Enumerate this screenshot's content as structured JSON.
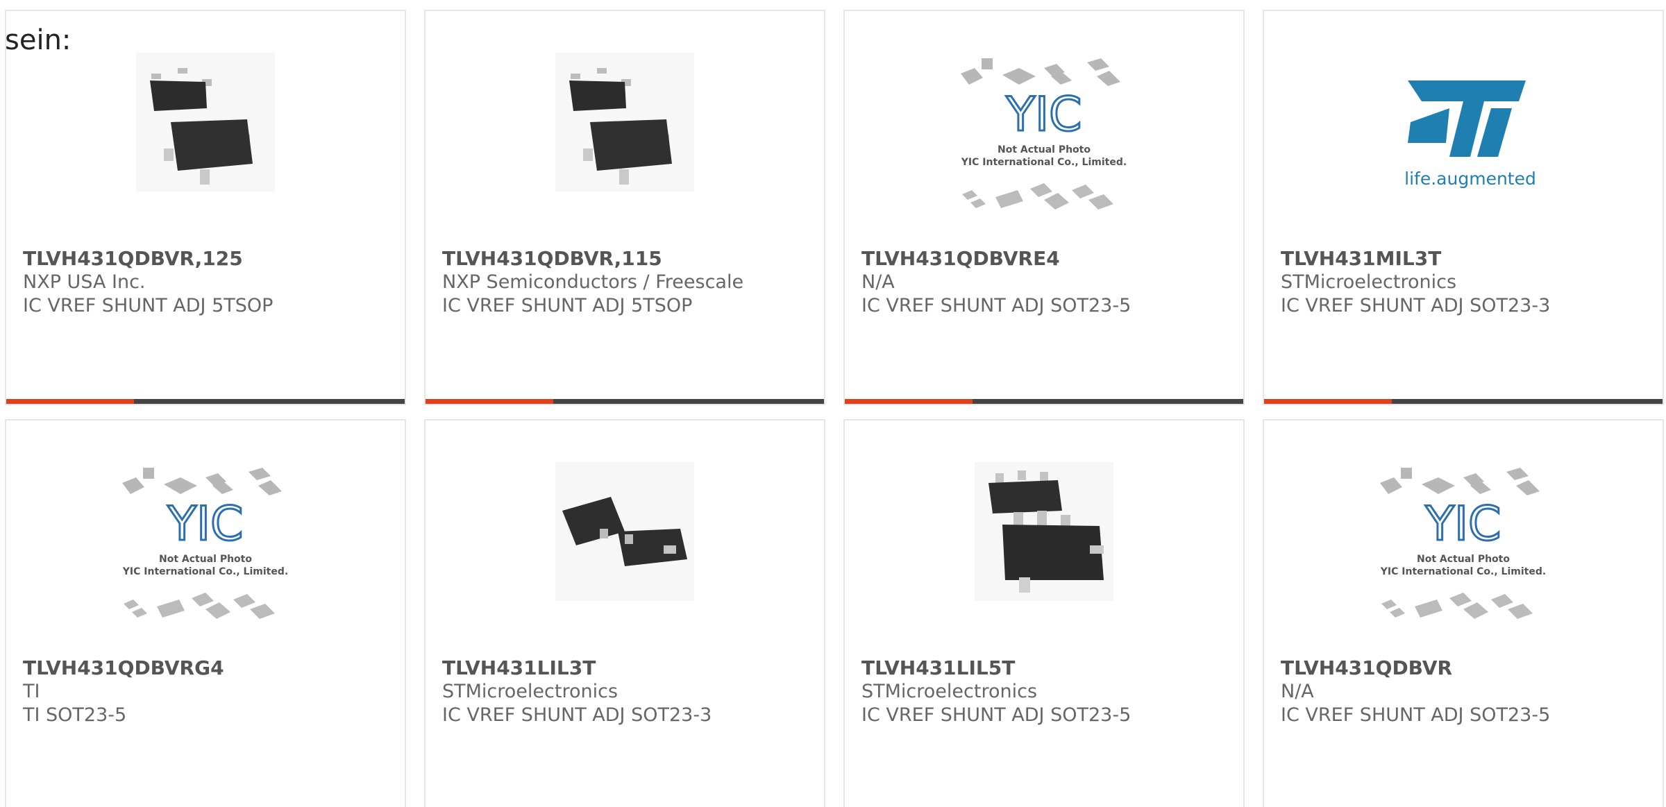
{
  "intro_text": "sein:",
  "colors": {
    "accent": "#e2401c",
    "bar": "#444444",
    "st_logo_blue": "#1e7fb0",
    "yic_blue": "#2b6fb0"
  },
  "products": [
    {
      "part_number": "TLVH431QDBVR,125",
      "manufacturer": "NXP USA Inc.",
      "description": "IC VREF SHUNT ADJ 5TSOP",
      "image": "chip-photo"
    },
    {
      "part_number": "TLVH431QDBVR,115",
      "manufacturer": "NXP Semiconductors / Freescale",
      "description": "IC VREF SHUNT ADJ 5TSOP",
      "image": "chip-photo"
    },
    {
      "part_number": "TLVH431QDBVRE4",
      "manufacturer": "N/A",
      "description": "IC VREF SHUNT ADJ SOT23-5",
      "image": "yic-placeholder"
    },
    {
      "part_number": "TLVH431MIL3T",
      "manufacturer": "STMicroelectronics",
      "description": "IC VREF SHUNT ADJ SOT23-3",
      "image": "st-logo"
    },
    {
      "part_number": "TLVH431QDBVRG4",
      "manufacturer": "TI",
      "description": "TI SOT23-5",
      "image": "yic-placeholder"
    },
    {
      "part_number": "TLVH431LIL3T",
      "manufacturer": "STMicroelectronics",
      "description": "IC VREF SHUNT ADJ SOT23-3",
      "image": "chip-photo"
    },
    {
      "part_number": "TLVH431LIL5T",
      "manufacturer": "STMicroelectronics",
      "description": "IC VREF SHUNT ADJ SOT23-5",
      "image": "chip-photo"
    },
    {
      "part_number": "TLVH431QDBVR",
      "manufacturer": "N/A",
      "description": "IC VREF SHUNT ADJ SOT23-5",
      "image": "yic-placeholder"
    }
  ],
  "placeholder": {
    "line1": "Not Actual Photo",
    "line2": "YIC International Co., Limited."
  },
  "st_logo": {
    "letters": "ST",
    "tagline": "life.augmented"
  }
}
